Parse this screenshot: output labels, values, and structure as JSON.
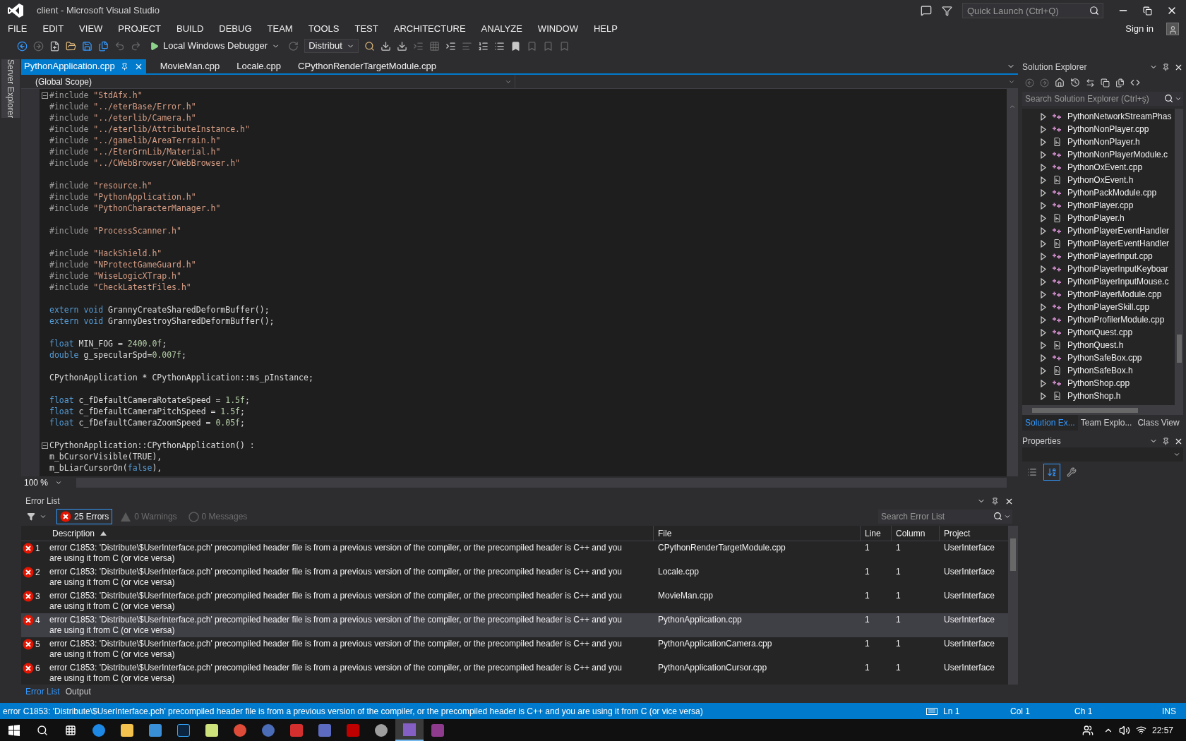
{
  "window": {
    "title": "client - Microsoft Visual Studio",
    "quick_launch": {
      "placeholder": "Quick Launch (Ctrl+Q)"
    },
    "sign_in": "Sign in"
  },
  "menu": [
    "FILE",
    "EDIT",
    "VIEW",
    "PROJECT",
    "BUILD",
    "DEBUG",
    "TEAM",
    "TOOLS",
    "TEST",
    "ARCHITECTURE",
    "ANALYZE",
    "WINDOW",
    "HELP"
  ],
  "toolbar": {
    "debugger": "Local Windows Debugger",
    "configuration": "Distribut"
  },
  "side_strip": "Server Explorer",
  "editor": {
    "tabs": [
      {
        "label": "PythonApplication.cpp",
        "selected": true
      },
      {
        "label": "MovieMan.cpp",
        "selected": false
      },
      {
        "label": "Locale.cpp",
        "selected": false
      },
      {
        "label": "CPythonRenderTargetModule.cpp",
        "selected": false
      }
    ],
    "scope": "(Global Scope)",
    "zoom": "100 %",
    "lines": [
      {
        "kind": "fold",
        "tokens": [
          {
            "kind": "preproc",
            "text": "#include"
          },
          {
            "kind": "string",
            "text": " \"StdAfx.h\""
          }
        ]
      },
      {
        "kind": "code",
        "tokens": [
          {
            "kind": "preproc",
            "text": "#include"
          },
          {
            "kind": "string",
            "text": " \"../eterBase/Error.h\""
          }
        ]
      },
      {
        "kind": "code",
        "tokens": [
          {
            "kind": "preproc",
            "text": "#include"
          },
          {
            "kind": "string",
            "text": " \"../eterlib/Camera.h\""
          }
        ]
      },
      {
        "kind": "code",
        "tokens": [
          {
            "kind": "preproc",
            "text": "#include"
          },
          {
            "kind": "string",
            "text": " \"../eterlib/AttributeInstance.h\""
          }
        ]
      },
      {
        "kind": "code",
        "tokens": [
          {
            "kind": "preproc",
            "text": "#include"
          },
          {
            "kind": "string",
            "text": " \"../gamelib/AreaTerrain.h\""
          }
        ]
      },
      {
        "kind": "code",
        "tokens": [
          {
            "kind": "preproc",
            "text": "#include"
          },
          {
            "kind": "string",
            "text": " \"../EterGrnLib/Material.h\""
          }
        ]
      },
      {
        "kind": "code",
        "tokens": [
          {
            "kind": "preproc",
            "text": "#include"
          },
          {
            "kind": "string",
            "text": " \"../CWebBrowser/CWebBrowser.h\""
          }
        ]
      },
      {
        "kind": "blank"
      },
      {
        "kind": "code",
        "tokens": [
          {
            "kind": "preproc",
            "text": "#include"
          },
          {
            "kind": "string",
            "text": " \"resource.h\""
          }
        ]
      },
      {
        "kind": "code",
        "tokens": [
          {
            "kind": "preproc",
            "text": "#include"
          },
          {
            "kind": "string",
            "text": " \"PythonApplication.h\""
          }
        ]
      },
      {
        "kind": "code",
        "tokens": [
          {
            "kind": "preproc",
            "text": "#include"
          },
          {
            "kind": "string",
            "text": " \"PythonCharacterManager.h\""
          }
        ]
      },
      {
        "kind": "blank"
      },
      {
        "kind": "code",
        "tokens": [
          {
            "kind": "preproc",
            "text": "#include"
          },
          {
            "kind": "string",
            "text": " \"ProcessScanner.h\""
          }
        ]
      },
      {
        "kind": "blank"
      },
      {
        "kind": "code",
        "tokens": [
          {
            "kind": "preproc",
            "text": "#include"
          },
          {
            "kind": "string",
            "text": " \"HackShield.h\""
          }
        ]
      },
      {
        "kind": "code",
        "tokens": [
          {
            "kind": "preproc",
            "text": "#include"
          },
          {
            "kind": "string",
            "text": " \"NProtectGameGuard.h\""
          }
        ]
      },
      {
        "kind": "code",
        "tokens": [
          {
            "kind": "preproc",
            "text": "#include"
          },
          {
            "kind": "string",
            "text": " \"WiseLogicXTrap.h\""
          }
        ]
      },
      {
        "kind": "code",
        "tokens": [
          {
            "kind": "preproc",
            "text": "#include"
          },
          {
            "kind": "string",
            "text": " \"CheckLatestFiles.h\""
          }
        ]
      },
      {
        "kind": "blank"
      },
      {
        "kind": "code",
        "tokens": [
          {
            "kind": "keyword",
            "text": "extern"
          },
          {
            "kind": "keyword",
            "text": " void"
          },
          {
            "kind": "plain",
            "text": " GrannyCreateSharedDeformBuffer();"
          }
        ]
      },
      {
        "kind": "code",
        "tokens": [
          {
            "kind": "keyword",
            "text": "extern"
          },
          {
            "kind": "keyword",
            "text": " void"
          },
          {
            "kind": "plain",
            "text": " GrannyDestroySharedDeformBuffer();"
          }
        ]
      },
      {
        "kind": "blank"
      },
      {
        "kind": "code",
        "tokens": [
          {
            "kind": "keyword",
            "text": "float"
          },
          {
            "kind": "plain",
            "text": " MIN_FOG = "
          },
          {
            "kind": "number",
            "text": "2400.0f"
          },
          {
            "kind": "plain",
            "text": ";"
          }
        ]
      },
      {
        "kind": "code",
        "tokens": [
          {
            "kind": "keyword",
            "text": "double"
          },
          {
            "kind": "plain",
            "text": " g_specularSpd="
          },
          {
            "kind": "number",
            "text": "0.007f"
          },
          {
            "kind": "plain",
            "text": ";"
          }
        ]
      },
      {
        "kind": "blank"
      },
      {
        "kind": "code",
        "tokens": [
          {
            "kind": "plain",
            "text": "CPythonApplication * CPythonApplication::ms_pInstance;"
          }
        ]
      },
      {
        "kind": "blank"
      },
      {
        "kind": "code",
        "tokens": [
          {
            "kind": "keyword",
            "text": "float"
          },
          {
            "kind": "plain",
            "text": " c_fDefaultCameraRotateSpeed = "
          },
          {
            "kind": "number",
            "text": "1.5f"
          },
          {
            "kind": "plain",
            "text": ";"
          }
        ]
      },
      {
        "kind": "code",
        "tokens": [
          {
            "kind": "keyword",
            "text": "float"
          },
          {
            "kind": "plain",
            "text": " c_fDefaultCameraPitchSpeed = "
          },
          {
            "kind": "number",
            "text": "1.5f"
          },
          {
            "kind": "plain",
            "text": ";"
          }
        ]
      },
      {
        "kind": "code",
        "tokens": [
          {
            "kind": "keyword",
            "text": "float"
          },
          {
            "kind": "plain",
            "text": " c_fDefaultCameraZoomSpeed = "
          },
          {
            "kind": "number",
            "text": "0.05f"
          },
          {
            "kind": "plain",
            "text": ";"
          }
        ]
      },
      {
        "kind": "blank"
      },
      {
        "kind": "fold",
        "tokens": [
          {
            "kind": "plain",
            "text": "CPythonApplication::CPythonApplication() :"
          }
        ]
      },
      {
        "kind": "code",
        "tokens": [
          {
            "kind": "plain",
            "text": "m_bCursorVisible(TRUE),"
          }
        ]
      },
      {
        "kind": "code",
        "tokens": [
          {
            "kind": "plain",
            "text": "m_bLiarCursorOn("
          },
          {
            "kind": "keyword",
            "text": "false"
          },
          {
            "kind": "plain",
            "text": "),"
          }
        ]
      }
    ]
  },
  "error_list": {
    "title": "Error List",
    "filters": [
      {
        "kind": "error",
        "label": "25 Errors",
        "selected": true
      },
      {
        "kind": "warning",
        "label": "0 Warnings",
        "selected": false
      },
      {
        "kind": "message",
        "label": "0 Messages",
        "selected": false
      }
    ],
    "search": {
      "placeholder": "Search Error List"
    },
    "columns": [
      "Description",
      "File",
      "Line",
      "Column",
      "Project"
    ],
    "rows": [
      {
        "number": "1",
        "description": "error C1853: 'Distribute\\$UserInterface.pch' precompiled header file is from a previous version of the compiler, or the precompiled header is C++ and you are using it from C (or vice versa)",
        "file": "CPythonRenderTargetModule.cpp",
        "line": "1",
        "column": "1",
        "project": "UserInterface",
        "selected": false
      },
      {
        "number": "2",
        "description": "error C1853: 'Distribute\\$UserInterface.pch' precompiled header file is from a previous version of the compiler, or the precompiled header is C++ and you are using it from C (or vice versa)",
        "file": "Locale.cpp",
        "line": "1",
        "column": "1",
        "project": "UserInterface",
        "selected": false
      },
      {
        "number": "3",
        "description": "error C1853: 'Distribute\\$UserInterface.pch' precompiled header file is from a previous version of the compiler, or the precompiled header is C++ and you are using it from C (or vice versa)",
        "file": "MovieMan.cpp",
        "line": "1",
        "column": "1",
        "project": "UserInterface",
        "selected": false
      },
      {
        "number": "4",
        "description": "error C1853: 'Distribute\\$UserInterface.pch' precompiled header file is from a previous version of the compiler, or the precompiled header is C++ and you are using it from C (or vice versa)",
        "file": "PythonApplication.cpp",
        "line": "1",
        "column": "1",
        "project": "UserInterface",
        "selected": true
      },
      {
        "number": "5",
        "description": "error C1853: 'Distribute\\$UserInterface.pch' precompiled header file is from a previous version of the compiler, or the precompiled header is C++ and you are using it from C (or vice versa)",
        "file": "PythonApplicationCamera.cpp",
        "line": "1",
        "column": "1",
        "project": "UserInterface",
        "selected": false
      },
      {
        "number": "6",
        "description": "error C1853: 'Distribute\\$UserInterface.pch' precompiled header file is from a previous version of the compiler, or the precompiled header is C++ and you are using it from C (or vice versa)",
        "file": "PythonApplicationCursor.cpp",
        "line": "1",
        "column": "1",
        "project": "UserInterface",
        "selected": false
      }
    ],
    "tabs": [
      {
        "label": "Error List",
        "selected": true
      },
      {
        "label": "Output",
        "selected": false
      }
    ]
  },
  "solution_explorer": {
    "title": "Solution Explorer",
    "search": {
      "placeholder": "Search Solution Explorer (Ctrl+ş)"
    },
    "items": [
      {
        "kind": "cpp",
        "name": "PythonNetworkStreamPhas"
      },
      {
        "kind": "cpp",
        "name": "PythonNonPlayer.cpp"
      },
      {
        "kind": "h",
        "name": "PythonNonPlayer.h"
      },
      {
        "kind": "cpp",
        "name": "PythonNonPlayerModule.c"
      },
      {
        "kind": "cpp",
        "name": "PythonOxEvent.cpp"
      },
      {
        "kind": "h",
        "name": "PythonOxEvent.h"
      },
      {
        "kind": "cpp",
        "name": "PythonPackModule.cpp"
      },
      {
        "kind": "cpp",
        "name": "PythonPlayer.cpp"
      },
      {
        "kind": "h",
        "name": "PythonPlayer.h"
      },
      {
        "kind": "cpp",
        "name": "PythonPlayerEventHandler"
      },
      {
        "kind": "h",
        "name": "PythonPlayerEventHandler"
      },
      {
        "kind": "cpp",
        "name": "PythonPlayerInput.cpp"
      },
      {
        "kind": "cpp",
        "name": "PythonPlayerInputKeyboar"
      },
      {
        "kind": "cpp",
        "name": "PythonPlayerInputMouse.c"
      },
      {
        "kind": "cpp",
        "name": "PythonPlayerModule.cpp"
      },
      {
        "kind": "cpp",
        "name": "PythonPlayerSkill.cpp"
      },
      {
        "kind": "cpp",
        "name": "PythonProfilerModule.cpp"
      },
      {
        "kind": "cpp",
        "name": "PythonQuest.cpp"
      },
      {
        "kind": "h",
        "name": "PythonQuest.h"
      },
      {
        "kind": "cpp",
        "name": "PythonSafeBox.cpp"
      },
      {
        "kind": "h",
        "name": "PythonSafeBox.h"
      },
      {
        "kind": "cpp",
        "name": "PythonShop.cpp"
      },
      {
        "kind": "h",
        "name": "PythonShop.h"
      }
    ],
    "tabs": [
      {
        "label": "Solution Ex...",
        "selected": true
      },
      {
        "label": "Team Explo...",
        "selected": false
      },
      {
        "label": "Class View",
        "selected": false
      }
    ]
  },
  "properties": {
    "title": "Properties",
    "buttons": [
      {
        "kind": "categorized",
        "selected": false
      },
      {
        "kind": "alphabetical",
        "selected": true
      },
      {
        "kind": "pages",
        "selected": false
      }
    ]
  },
  "status_bar": {
    "message": "error C1853: 'Distribute\\$UserInterface.pch' precompiled header file is from a previous version of the compiler, or the precompiled header is C++ and you are using it from C (or vice versa)",
    "line": "Ln 1",
    "column": "Col 1",
    "char": "Ch 1",
    "mode": "INS"
  },
  "taskbar": {
    "clock": "22:57"
  }
}
